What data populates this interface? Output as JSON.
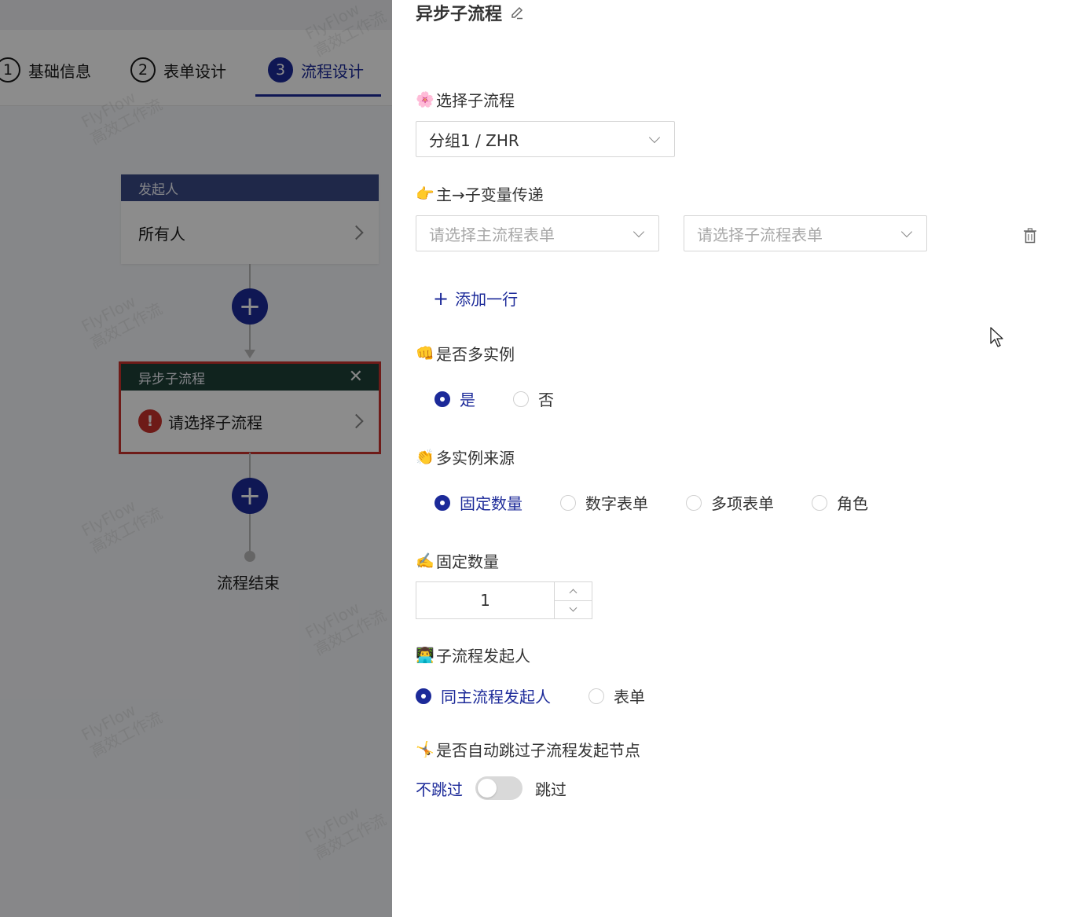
{
  "steps": [
    {
      "num": "1",
      "label": "基础信息"
    },
    {
      "num": "2",
      "label": "表单设计"
    },
    {
      "num": "3",
      "label": "流程设计"
    }
  ],
  "flow": {
    "starter": {
      "header": "发起人",
      "value": "所有人"
    },
    "subprocess": {
      "header": "异步子流程",
      "value": "请选择子流程",
      "close": "✕",
      "error": "!"
    },
    "add_symbol": "+",
    "end_label": "流程结束"
  },
  "drawer": {
    "title": "异步子流程",
    "select_subprocess": {
      "emoji": "🌸",
      "label": "选择子流程",
      "value": "分组1 / ZHR"
    },
    "var_pass": {
      "emoji": "👉",
      "label": "主→子变量传递",
      "main_placeholder": "请选择主流程表单",
      "sub_placeholder": "请选择子流程表单",
      "add_row": "添加一行",
      "add_symbol": "+"
    },
    "multi_instance": {
      "emoji": "👊",
      "label": "是否多实例",
      "options": [
        "是",
        "否"
      ],
      "selected": 0
    },
    "instance_source": {
      "emoji": "👏",
      "label": "多实例来源",
      "options": [
        "固定数量",
        "数字表单",
        "多项表单",
        "角色"
      ],
      "selected": 0
    },
    "fixed_count": {
      "emoji": "✍️",
      "label": "固定数量",
      "value": "1"
    },
    "sub_starter": {
      "emoji": "👨‍💻",
      "label": "子流程发起人",
      "options": [
        "同主流程发起人",
        "表单"
      ],
      "selected": 0
    },
    "auto_skip": {
      "emoji": "🤸",
      "label": "是否自动跳过子流程发起节点",
      "off_label": "不跳过",
      "on_label": "跳过",
      "on": false
    }
  },
  "colors": {
    "accent": "#1c2a99",
    "error": "#c8322d",
    "starter_header": "#3a4a86",
    "subprocess_header": "#1e4038"
  }
}
